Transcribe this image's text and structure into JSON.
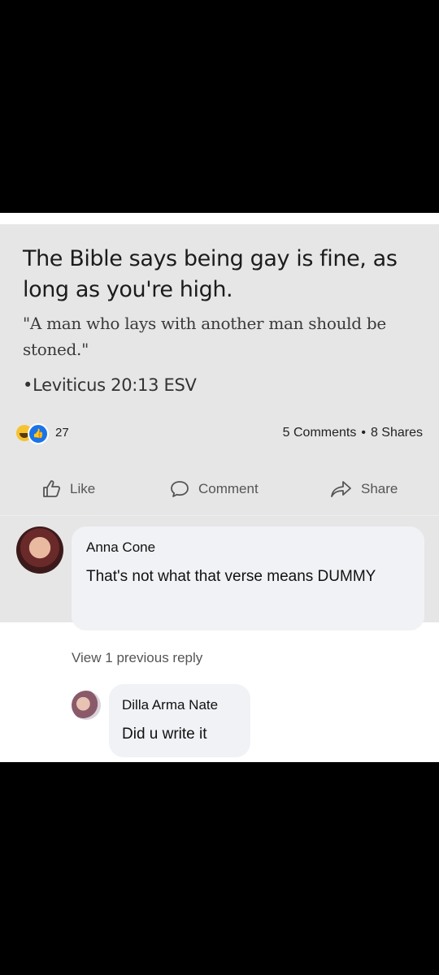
{
  "image": {
    "headline": "The Bible says being gay is fine, as long as you're high.",
    "quote": "\"A man who lays with another man should be stoned.\"",
    "citation": "•Leviticus 20:13 ESV"
  },
  "reactions": {
    "count": "27",
    "icons": [
      "haha-icon",
      "like-icon"
    ],
    "comments": "5 Comments",
    "separator": "•",
    "shares": "8 Shares"
  },
  "actions": {
    "like": "Like",
    "comment": "Comment",
    "share": "Share"
  },
  "comments": [
    {
      "author": "Anna Cone",
      "text": "That's not what that verse means DUMMY"
    }
  ],
  "view_replies": "View 1 previous reply",
  "reply": {
    "author": "Dilla Arma Nate",
    "text": "Did u write it"
  },
  "colors": {
    "like_blue": "#1a74e8",
    "haha_yellow": "#f7c22f",
    "bubble_gray": "#f0f2f5"
  }
}
